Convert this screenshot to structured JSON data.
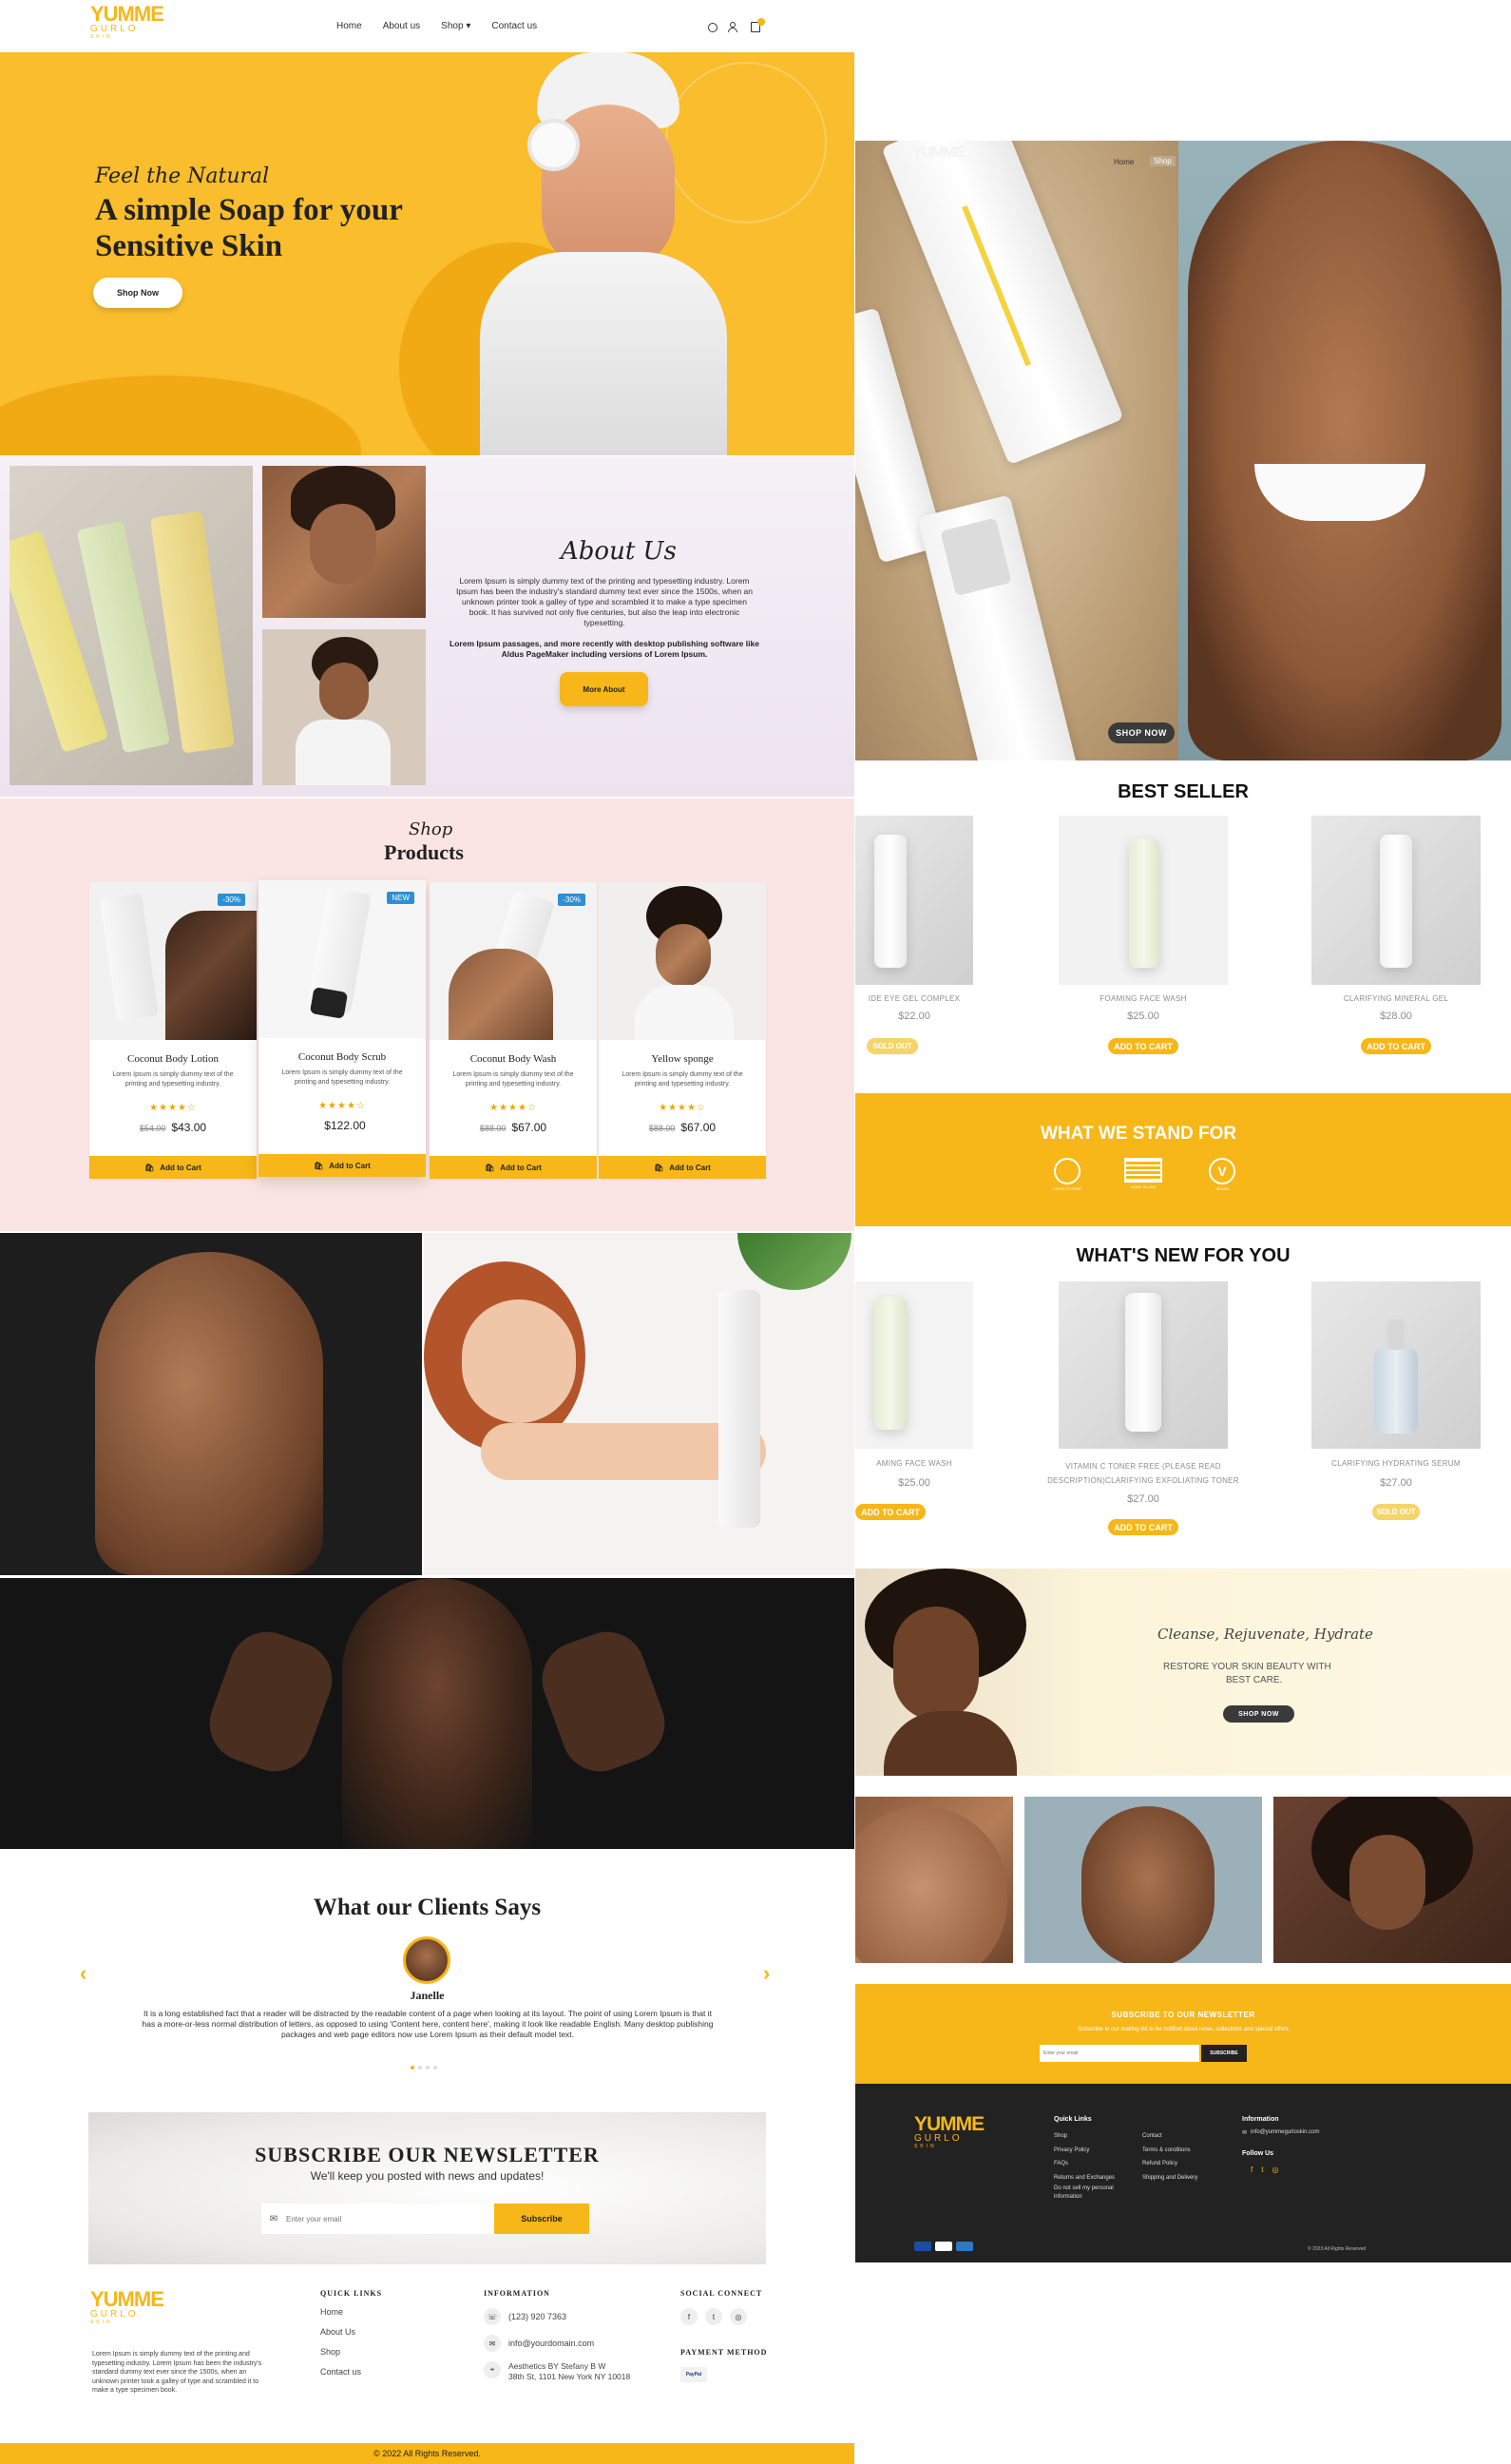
{
  "brand": {
    "name_top": "YUMME",
    "name_bottom": "GURLO",
    "tagline": "SKIN",
    "accent": "#f7b718",
    "soldout": "#f5d569"
  },
  "nav": {
    "items": [
      "Home",
      "About us",
      "Shop",
      "Contact us"
    ],
    "shop_caret": "▾"
  },
  "hero": {
    "script": "Feel the Natural",
    "title_line1": "A simple Soap for your",
    "title_line2": "Sensitive Skin",
    "button": "Shop Now"
  },
  "about": {
    "script": "About Us",
    "para1": "Lorem Ipsum is simply dummy text of the printing and typesetting industry. Lorem Ipsum has been the industry's standard dummy text ever since the 1500s, when an unknown printer took a galley of type and scrambled it to make a type specimen book. It has survived not only five centuries, but also the leap into electronic typesetting.",
    "para2": "Lorem Ipsum passages, and more recently with desktop publishing software like Aldus PageMaker including versions of Lorem Ipsum.",
    "button": "More About"
  },
  "products": {
    "script": "Shop",
    "title": "Products",
    "items": [
      {
        "name": "Coconut Body Lotion",
        "desc": "Lorem Ipsum is simply dummy text of the printing and typesetting industry.",
        "stars": "★★★★☆",
        "old": "$54.00",
        "price": "$43.00",
        "badge": "-30%",
        "cart": "Add to Cart"
      },
      {
        "name": "Coconut Body Scrub",
        "desc": "Lorem Ipsum is simply dummy text of the printing and typesetting industry.",
        "stars": "★★★★☆",
        "old": "",
        "price": "$122.00",
        "badge": "NEW",
        "cart": "Add to Cart"
      },
      {
        "name": "Coconut Body Wash",
        "desc": "Lorem Ipsum is simply dummy text of the printing and typesetting industry.",
        "stars": "★★★★☆",
        "old": "$88.00",
        "price": "$67.00",
        "badge": "-30%",
        "cart": "Add to Cart"
      },
      {
        "name": "Yellow sponge",
        "desc": "Lorem Ipsum is simply dummy text of the printing and typesetting industry.",
        "stars": "★★★★☆",
        "old": "$88.00",
        "price": "$67.00",
        "badge": "",
        "cart": "Add to Cart"
      }
    ]
  },
  "testimonials": {
    "title": "What our Clients Says",
    "name": "Janelle",
    "text": "It is a long established fact that a reader will be distracted by the readable content of a page when looking at its layout. The point of using Lorem Ipsum is that it has a more-or-less normal distribution of letters, as opposed to using 'Content here, content here', making it look like readable English. Many desktop publishing packages and web page editors now use Lorem Ipsum as their default model text.",
    "prev": "‹",
    "next": "›"
  },
  "newsletter": {
    "title": "SUBSCRIBE OUR NEWSLETTER",
    "subtitle": "We'll keep you posted with news and updates!",
    "placeholder": "Enter your email",
    "button": "Subscribe"
  },
  "footer": {
    "about": "Lorem Ipsum is simply dummy text of the printing and typesetting industry. Lorem Ipsum has been the industry's standard dummy text ever since the 1500s, when an unknown printer took a galley of type and scrambled it to make a type specimen book.",
    "quick_title": "QUICK LINKS",
    "quick": [
      "Home",
      "About Us",
      "Shop",
      "Contact us"
    ],
    "info_title": "INFORMATION",
    "phone": "(123) 920 7363",
    "email": "info@yourdomain.com",
    "address1": "Aesthetics BY Stefany B W",
    "address2": "38th St, 1101 New York NY 10018",
    "social_title": "SOCIAL CONNECT",
    "payment_title": "PAYMENT METHOD",
    "payment": "PayPal",
    "copyright": "© 2022 All Rights Reserved."
  },
  "right": {
    "nav": [
      "Home",
      "Shop"
    ],
    "hero_button": "SHOP NOW",
    "bestseller_title": "BEST SELLER",
    "bestseller": [
      {
        "name": "IDE EYE GEL COMPLEX",
        "price": "$22.00",
        "button": "SOLD OUT"
      },
      {
        "name": "FOAMING FACE WASH",
        "price": "$25.00",
        "button": "ADD TO CART"
      },
      {
        "name": "CLARIFYING MINERAL GEL",
        "price": "$28.00",
        "button": "ADD TO CART"
      }
    ],
    "stand_title": "WHAT WE STAND FOR",
    "stand_icons": [
      "CRUELTY FREE",
      "MADE IN USA",
      "VEGAN"
    ],
    "new_title": "WHAT'S NEW FOR YOU",
    "new": [
      {
        "name": "AMING FACE WASH",
        "price": "$25.00",
        "button": "ADD TO CART"
      },
      {
        "name": "VITAMIN C TONER FREE (PLEASE READ DESCRIPTION)CLARIFYING EXFOLIATING TONER",
        "price": "$27.00",
        "button": "ADD TO CART"
      },
      {
        "name": "CLARIFYING HYDRATING SERUM",
        "price": "$27.00",
        "button": "SOLD OUT"
      }
    ],
    "promo_script": "Cleanse, Rejuvenate, Hydrate",
    "promo_text1": "RESTORE YOUR SKIN BEAUTY WITH",
    "promo_text2": "BEST CARE.",
    "promo_button": "SHOP NOW",
    "news_title": "SUBSCRIBE TO OUR NEWSLETTER",
    "news_sub": "Subscribe to our mailing list to be notified about news, collections and special offers",
    "news_placeholder": "Enter your email",
    "news_button": "SUBSCRIBE",
    "foot_quick_title": "Quick Links",
    "foot_quick_col1": [
      "Shop",
      "Privacy Policy",
      "FAQs",
      "Returns and Exchanges",
      "Do not sell my personal information"
    ],
    "foot_quick_col2": [
      "Contact",
      "Terms & conditions",
      "Refund Policy",
      "Shipping and Delivery"
    ],
    "foot_info_title": "Information",
    "foot_email": "info@yummegurloskin.com",
    "foot_follow": "Follow Us",
    "foot_copyright": "© 2023 All Rights Reserved"
  }
}
